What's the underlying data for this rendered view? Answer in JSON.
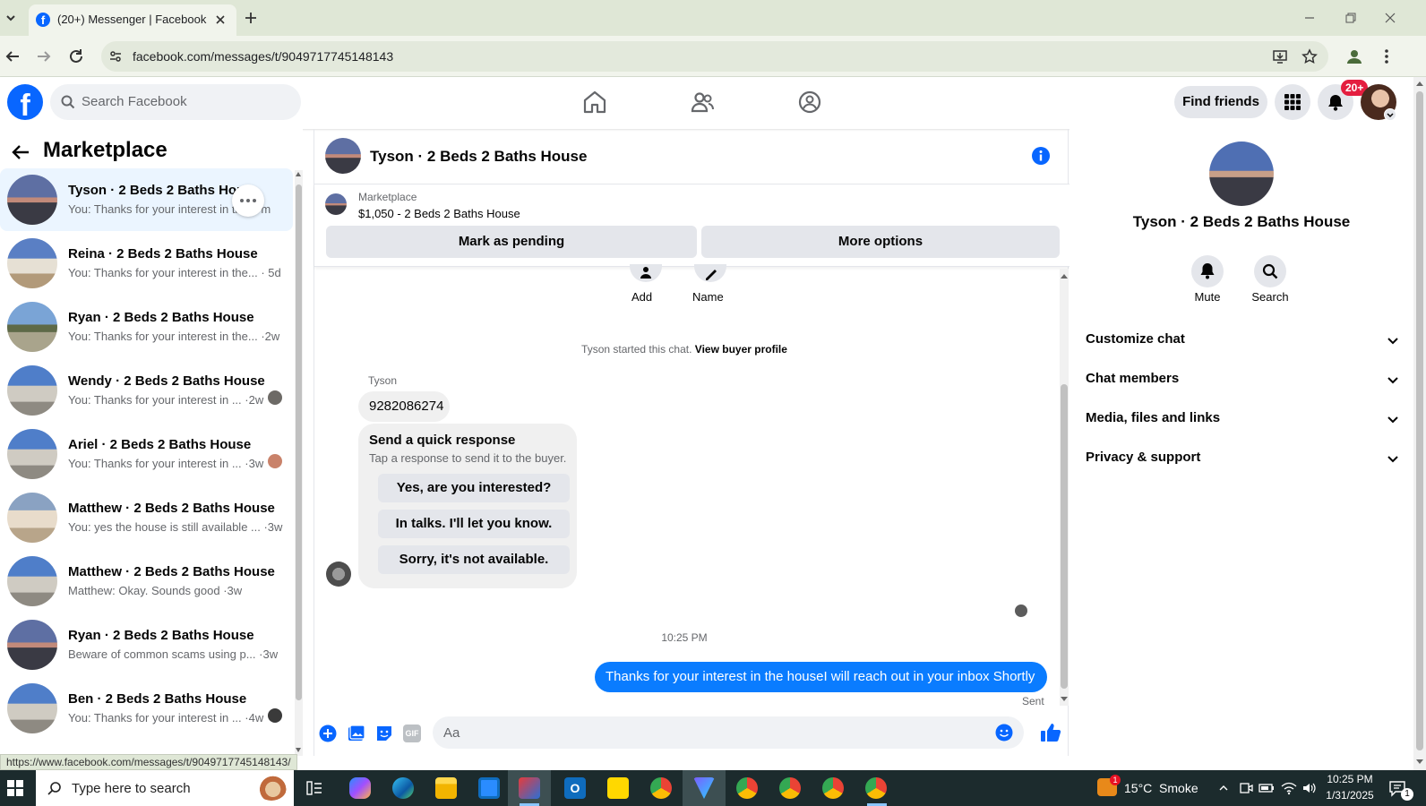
{
  "browser": {
    "tab_title": "(20+) Messenger | Facebook",
    "url": "facebook.com/messages/t/9049717745148143",
    "status_url": "https://www.facebook.com/messages/t/9049717745148143/"
  },
  "header": {
    "search_placeholder": "Search Facebook",
    "find_friends": "Find friends",
    "notif_badge": "20+"
  },
  "sidebar": {
    "title": "Marketplace",
    "conversations": [
      {
        "name": "Tyson · 2 Beds 2 Baths House",
        "preview": "You: Thanks for your interest in the... m"
      },
      {
        "name": "Reina · 2 Beds 2 Baths House",
        "preview": "You: Thanks for your interest in the... · 5d"
      },
      {
        "name": "Ryan · 2 Beds 2 Baths House",
        "preview": "You: Thanks for your interest in the... ·2w"
      },
      {
        "name": "Wendy · 2 Beds 2 Baths House",
        "preview": "You: Thanks for your interest in ... ·2w"
      },
      {
        "name": "Ariel · 2 Beds 2 Baths House",
        "preview": "You: Thanks for your interest in ... ·3w"
      },
      {
        "name": "Matthew · 2 Beds 2 Baths House",
        "preview": "You: yes the house is still available ... ·3w"
      },
      {
        "name": "Matthew · 2 Beds 2 Baths House",
        "preview": "Matthew: Okay. Sounds good ·3w"
      },
      {
        "name": "Ryan · 2 Beds 2 Baths House",
        "preview": "Beware of common scams using p... ·3w"
      },
      {
        "name": "Ben · 2 Beds 2 Baths House",
        "preview": "You: Thanks for your interest in ... ·4w"
      }
    ]
  },
  "chat": {
    "title": "Tyson · 2 Beds 2 Baths House",
    "listing_source": "Marketplace",
    "listing_desc": "$1,050 - 2 Beds 2 Baths House",
    "mark_pending": "Mark as pending",
    "more_options": "More options",
    "action_add": "Add",
    "action_name": "Name",
    "started_text": "Tyson started this chat.",
    "view_buyer": "View buyer profile",
    "sender_name": "Tyson",
    "incoming_msg": "9282086274",
    "quick_title": "Send a quick response",
    "quick_sub": "Tap a response to send it to the buyer.",
    "quick_responses": [
      "Yes, are you interested?",
      "In talks. I'll let you know.",
      "Sorry, it's not available."
    ],
    "timestamp": "10:25 PM",
    "outgoing_msg": "Thanks for your interest in the houseI will reach out in your inbox Shortly",
    "sent_label": "Sent",
    "composer_placeholder": "Aa",
    "gif_label": "GIF"
  },
  "right_panel": {
    "title": "Tyson · 2 Beds 2 Baths House",
    "mute": "Mute",
    "search": "Search",
    "sections": [
      "Customize chat",
      "Chat members",
      "Media, files and links",
      "Privacy & support"
    ]
  },
  "taskbar": {
    "search_placeholder": "Type here to search",
    "weather": "15°C  Smoke",
    "time": "10:25 PM",
    "date": "1/31/2025",
    "notif_count": "1"
  },
  "colors": {
    "fb_blue": "#0866ff",
    "messenger_blue": "#0a7cff",
    "badge_red": "#e41e3f"
  }
}
